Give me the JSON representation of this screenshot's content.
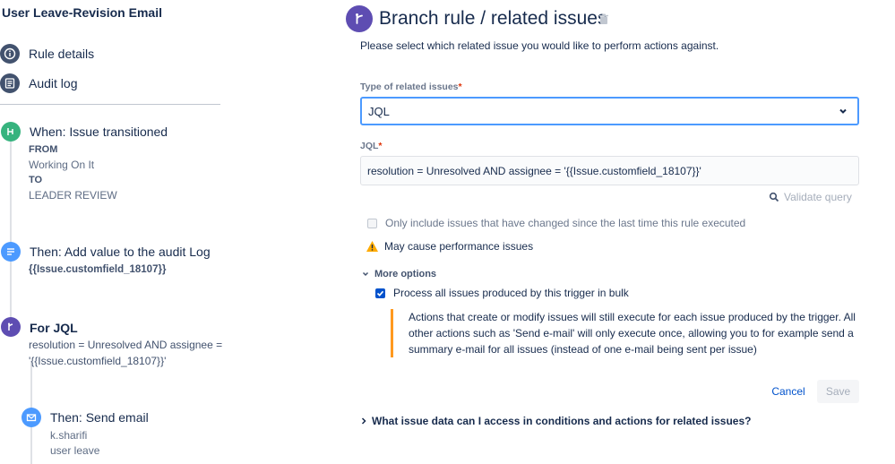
{
  "sidebar": {
    "rule_title": "User Leave-Revision Email",
    "nav": [
      {
        "label": "Rule details",
        "icon": "info-icon"
      },
      {
        "label": "Audit log",
        "icon": "audit-log-icon"
      }
    ],
    "components": [
      {
        "icon": "trigger-icon",
        "color": "#36b37e",
        "heading": "When: Issue transitioned",
        "from_label": "FROM",
        "from_value": "Working On It",
        "to_label": "TO",
        "to_value": "LEADER REVIEW"
      },
      {
        "icon": "audit-action-icon",
        "color": "#4c9aff",
        "heading": "Then: Add value to the audit Log",
        "value": "{{Issue.customfield_18107}}"
      },
      {
        "icon": "branch-icon",
        "color": "#5e4db2",
        "heading": "For JQL",
        "line1": "resolution = Unresolved AND assignee =",
        "line2": "'{{Issue.customfield_18107}}'"
      },
      {
        "icon": "email-icon",
        "color": "#4c9aff",
        "heading": "Then: Send email",
        "line1": "k.sharifi",
        "line2": "user leave"
      }
    ]
  },
  "main": {
    "title": "Branch rule / related issues",
    "subtitle": "Please select which related issue you would like to perform actions against.",
    "type_label": "Type of related issues",
    "type_value": "JQL",
    "jql_label": "JQL",
    "required_marker": "*",
    "jql_value": "resolution = Unresolved AND assignee = '{{Issue.customfield_18107}}'",
    "validate_label": "Validate query",
    "only_changed_label": "Only include issues that have changed since the last time this rule executed",
    "only_changed_checked": false,
    "warning_text": "May cause performance issues",
    "more_options_label": "More options",
    "bulk_label": "Process all issues produced by this trigger in bulk",
    "bulk_checked": true,
    "note_lines": [
      "Actions that create or modify issues will still execute for each issue produced by the trigger. All",
      "other actions such as 'Send e-mail' will only execute once, allowing you to for example send a",
      "summary e-mail for all issues (instead of one e-mail being sent per issue)"
    ],
    "cancel_label": "Cancel",
    "save_label": "Save",
    "faq_label": "What issue data can I access in conditions and actions for related issues?"
  },
  "colors": {
    "accent": "#0052cc",
    "branch": "#5e4db2",
    "warning": "#ff991f",
    "trigger": "#36b37e"
  }
}
